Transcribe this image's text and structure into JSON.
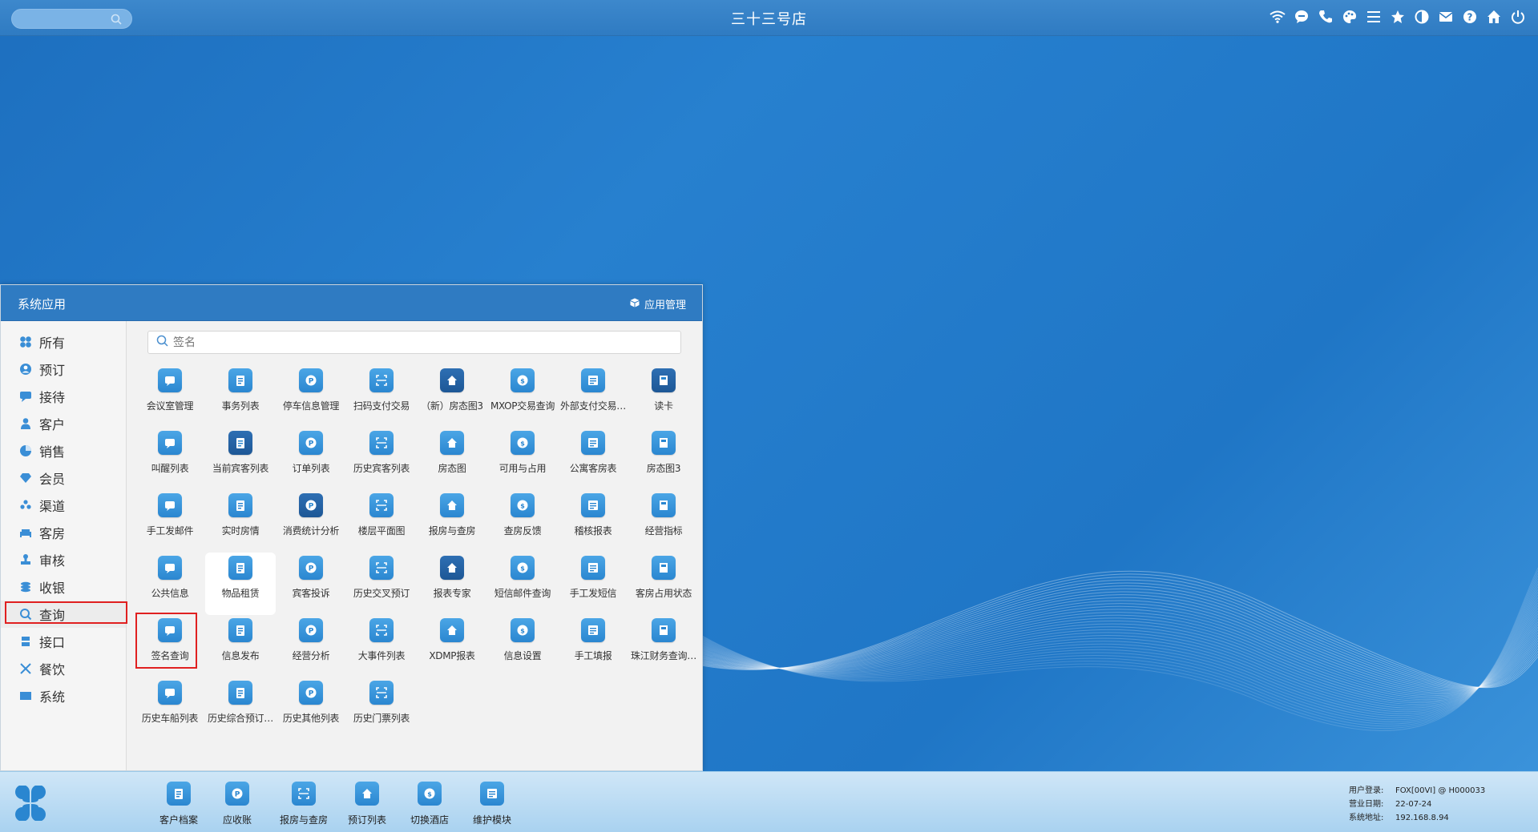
{
  "topbar": {
    "store_name": "三十三号店",
    "search_placeholder": "",
    "icons": [
      "wifi-icon",
      "chat-icon",
      "phone-icon",
      "palette-icon",
      "menu-icon",
      "star-icon",
      "contrast-icon",
      "mail-icon",
      "help-icon",
      "home-icon",
      "power-icon"
    ]
  },
  "panel": {
    "title": "系统应用",
    "app_manage": "应用管理",
    "search_placeholder": "签名",
    "sidebar": [
      {
        "label": "所有",
        "icon": "grid-icon"
      },
      {
        "label": "预订",
        "icon": "user-circle-icon"
      },
      {
        "label": "接待",
        "icon": "chat-icon"
      },
      {
        "label": "客户",
        "icon": "person-icon"
      },
      {
        "label": "销售",
        "icon": "pie-icon"
      },
      {
        "label": "会员",
        "icon": "diamond-icon"
      },
      {
        "label": "渠道",
        "icon": "group-icon"
      },
      {
        "label": "客房",
        "icon": "bed-icon"
      },
      {
        "label": "审核",
        "icon": "stamp-icon"
      },
      {
        "label": "收银",
        "icon": "coins-icon"
      },
      {
        "label": "查询",
        "icon": "search-icon"
      },
      {
        "label": "接口",
        "icon": "plug-icon"
      },
      {
        "label": "餐饮",
        "icon": "utensils-icon"
      },
      {
        "label": "系统",
        "icon": "monitor-icon"
      }
    ],
    "apps": [
      {
        "label": "会议室管理",
        "icon": "meeting-icon"
      },
      {
        "label": "事务列表",
        "icon": "clipboard-icon"
      },
      {
        "label": "停车信息管理",
        "icon": "parking-icon"
      },
      {
        "label": "扫码支付交易",
        "icon": "scan-icon"
      },
      {
        "label": "（新）房态图3",
        "icon": "house-icon"
      },
      {
        "label": "MXOP交易查询",
        "icon": "exchange-icon"
      },
      {
        "label": "外部支付交易…",
        "icon": "receipt-icon"
      },
      {
        "label": "读卡",
        "icon": "card-reader-icon"
      },
      {
        "label": "叫醒列表",
        "icon": "alarm-icon"
      },
      {
        "label": "当前宾客列表",
        "icon": "guest-badge-icon"
      },
      {
        "label": "订单列表",
        "icon": "list-icon"
      },
      {
        "label": "历史宾客列表",
        "icon": "history-doc-icon"
      },
      {
        "label": "房态图",
        "icon": "bank-icon"
      },
      {
        "label": "可用与占用",
        "icon": "pie-chart-icon"
      },
      {
        "label": "公寓客房表",
        "icon": "apartment-icon"
      },
      {
        "label": "房态图3",
        "icon": "home-roof-icon"
      },
      {
        "label": "手工发邮件",
        "icon": "mail-send-icon"
      },
      {
        "label": "实时房情",
        "icon": "gauge-icon"
      },
      {
        "label": "消费统计分析",
        "icon": "bar-chart-icon"
      },
      {
        "label": "楼层平面图",
        "icon": "layers-icon"
      },
      {
        "label": "报房与查房",
        "icon": "house-search-icon"
      },
      {
        "label": "查房反馈",
        "icon": "edit-icon"
      },
      {
        "label": "稽核报表",
        "icon": "shield-search-icon"
      },
      {
        "label": "经营指标",
        "icon": "trend-icon"
      },
      {
        "label": "公共信息",
        "icon": "cube-icon"
      },
      {
        "label": "物品租赁",
        "icon": "box-icon"
      },
      {
        "label": "宾客投诉",
        "icon": "complaint-icon"
      },
      {
        "label": "历史交叉预订",
        "icon": "clipboard-check-icon"
      },
      {
        "label": "报表专家",
        "icon": "graduation-icon"
      },
      {
        "label": "短信邮件查询",
        "icon": "envelope-icon"
      },
      {
        "label": "手工发短信",
        "icon": "sms-icon"
      },
      {
        "label": "客房占用状态",
        "icon": "occupancy-icon"
      },
      {
        "label": "签名查询",
        "icon": "signature-search-icon"
      },
      {
        "label": "信息发布",
        "icon": "send-icon"
      },
      {
        "label": "经营分析",
        "icon": "analysis-icon"
      },
      {
        "label": "大事件列表",
        "icon": "siren-icon"
      },
      {
        "label": "XDMP报表",
        "icon": "report-icon"
      },
      {
        "label": "信息设置",
        "icon": "gear-icon"
      },
      {
        "label": "手工填报",
        "icon": "form-edit-icon"
      },
      {
        "label": "珠江财务查询…",
        "icon": "finance-icon"
      },
      {
        "label": "历史车船列表",
        "icon": "ship-icon"
      },
      {
        "label": "历史综合预订…",
        "icon": "calendar-icon"
      },
      {
        "label": "历史其他列表",
        "icon": "clock-list-icon"
      },
      {
        "label": "历史门票列表",
        "icon": "ticket-icon"
      }
    ]
  },
  "taskbar": {
    "items": [
      {
        "label": "客户档案",
        "icon": "profile-icon"
      },
      {
        "label": "应收账",
        "icon": "receivable-icon"
      },
      {
        "label": "报房与查房",
        "icon": "house-search-icon"
      },
      {
        "label": "预订列表",
        "icon": "booking-list-icon"
      },
      {
        "label": "切换酒店",
        "icon": "switch-icon"
      },
      {
        "label": "维护模块",
        "icon": "wrench-icon"
      }
    ],
    "sysinfo": {
      "user_label": "用户登录:",
      "user_value": "FOX[00VI] @ H000033",
      "date_label": "营业日期:",
      "date_value": "22-07-24",
      "ip_label": "系统地址:",
      "ip_value": "192.168.8.94"
    }
  },
  "colors": {
    "accent": "#2f7bc2",
    "highlight": "#e02020",
    "icon_blue": "#2a86d0"
  }
}
